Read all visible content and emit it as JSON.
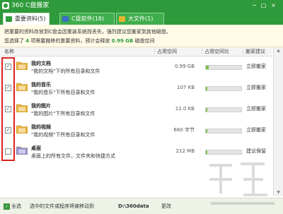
{
  "window": {
    "title": "360 C盘搬家",
    "controls": [
      "─",
      "□",
      "×"
    ]
  },
  "tabs": [
    {
      "label": "重要资料(5)",
      "icon_color": "#2f9a3b",
      "active": true
    },
    {
      "label": "C盘软件(18)",
      "icon_color": "#3b6cc7",
      "active": false
    },
    {
      "label": "大文件(1)",
      "icon_color": "#e8b52e",
      "active": false
    }
  ],
  "info": {
    "line1": "把重要的资料存放到C盘会因重装系统而丢失，强烈建议您搬家到其他磁盘。",
    "line2_prefix": "您选择了",
    "line2_count": "4",
    "line2_middle": "项需要搬移的重要资料，预计会释放",
    "line2_size": "0.99 GB",
    "line2_suffix": "磁盘空间"
  },
  "columns": {
    "name": "名称",
    "size": "占用空间",
    "ratio": "占用空间比",
    "suggest": "搬家建议"
  },
  "rows": [
    {
      "checked": true,
      "name": "我的文档",
      "desc": "\"我的文档\"下的所有目录和文件",
      "size": "0.99 GB",
      "ratio": 0.08,
      "action": "立即搬家",
      "icon": "documents-folder-icon"
    },
    {
      "checked": true,
      "name": "我的音乐",
      "desc": "\"我的音乐\"下所有目录和文件",
      "size": "107 KB",
      "ratio": 0.03,
      "action": "立即搬家",
      "icon": "music-folder-icon"
    },
    {
      "checked": true,
      "name": "我的图片",
      "desc": "\"我的图片\"下所有目录和文件",
      "size": "11.0 KB",
      "ratio": 0.03,
      "action": "立即搬家",
      "icon": "pictures-folder-icon"
    },
    {
      "checked": true,
      "name": "我的视频",
      "desc": "\"我的视频\"下所有目录和文件",
      "size": "660 字节",
      "ratio": 0.03,
      "action": "立即搬家",
      "icon": "videos-folder-icon"
    },
    {
      "checked": false,
      "name": "桌面",
      "desc": "桌面上的所有文件，文件夹和快捷方式",
      "size": "212 MB",
      "ratio": 0.03,
      "action": "建议保留",
      "icon": "desktop-icon"
    }
  ],
  "footer": {
    "select_all": "全选",
    "note": "选中的文件或程序将被移动到",
    "path": "D:\\360data",
    "change": "更改"
  },
  "colors": {
    "accent": "#2f9a3b",
    "highlight_box": "#e02020"
  }
}
